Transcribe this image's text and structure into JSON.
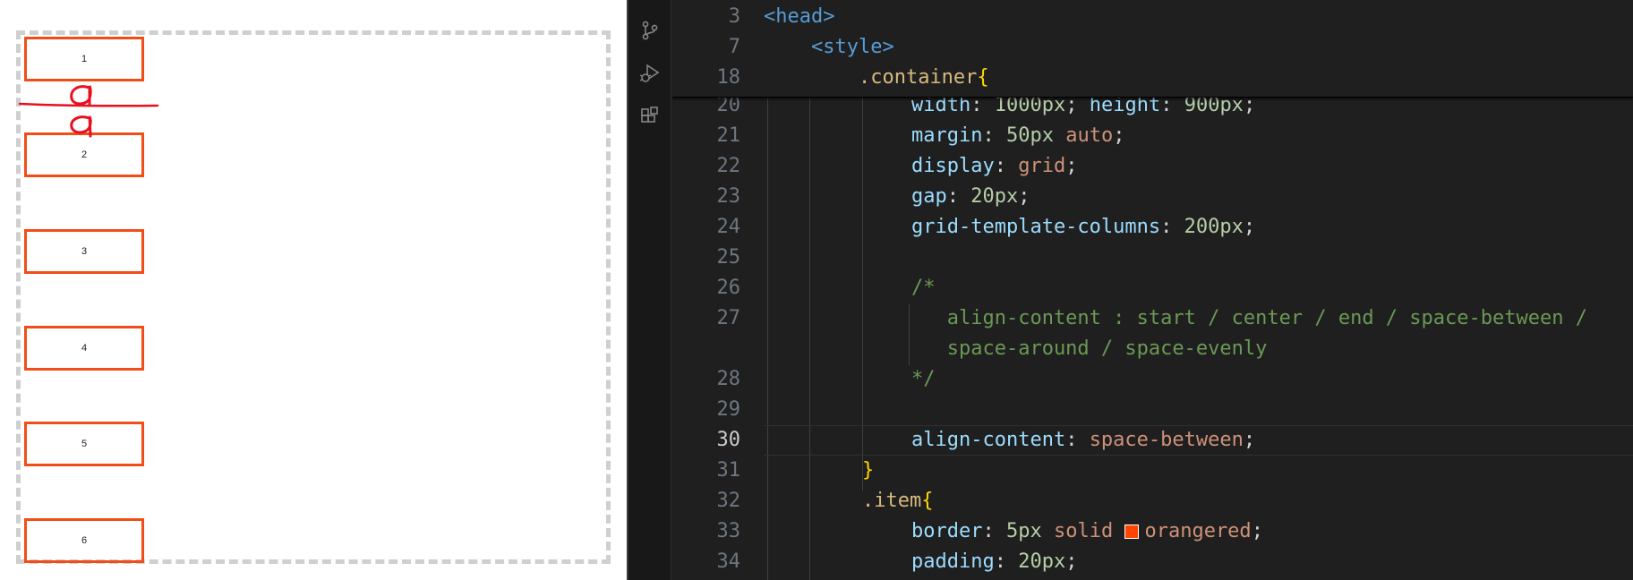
{
  "preview": {
    "items": [
      "1",
      "2",
      "3",
      "4",
      "5",
      "6"
    ],
    "annotation": "handwritten red strokes between item 1 and item 2"
  },
  "activity_bar": {
    "icons": [
      "source-control-icon",
      "run-debug-icon",
      "extensions-icon"
    ]
  },
  "editor": {
    "sticky": [
      {
        "ln": "3",
        "indent": "",
        "parts": [
          {
            "c": "tag",
            "t": "<head>"
          }
        ]
      },
      {
        "ln": "7",
        "indent": "    ",
        "parts": [
          {
            "c": "tag",
            "t": "<style>"
          }
        ]
      },
      {
        "ln": "18",
        "indent": "        ",
        "parts": [
          {
            "c": "sel",
            "t": ".container"
          },
          {
            "c": "brace",
            "t": "{"
          }
        ]
      }
    ],
    "lines": [
      {
        "ln": "20",
        "parts": [
          {
            "c": "prop",
            "t": "width"
          },
          {
            "c": "plain",
            "t": ": "
          },
          {
            "c": "num",
            "t": "1000px"
          },
          {
            "c": "plain",
            "t": "; "
          },
          {
            "c": "prop",
            "t": "height"
          },
          {
            "c": "plain",
            "t": ": "
          },
          {
            "c": "num",
            "t": "900px"
          },
          {
            "c": "plain",
            "t": ";"
          }
        ]
      },
      {
        "ln": "21",
        "parts": [
          {
            "c": "prop",
            "t": "margin"
          },
          {
            "c": "plain",
            "t": ": "
          },
          {
            "c": "num",
            "t": "50px"
          },
          {
            "c": "plain",
            "t": " "
          },
          {
            "c": "kw",
            "t": "auto"
          },
          {
            "c": "plain",
            "t": ";"
          }
        ]
      },
      {
        "ln": "22",
        "parts": [
          {
            "c": "prop",
            "t": "display"
          },
          {
            "c": "plain",
            "t": ": "
          },
          {
            "c": "kw",
            "t": "grid"
          },
          {
            "c": "plain",
            "t": ";"
          }
        ]
      },
      {
        "ln": "23",
        "parts": [
          {
            "c": "prop",
            "t": "gap"
          },
          {
            "c": "plain",
            "t": ": "
          },
          {
            "c": "num",
            "t": "20px"
          },
          {
            "c": "plain",
            "t": ";"
          }
        ]
      },
      {
        "ln": "24",
        "parts": [
          {
            "c": "prop",
            "t": "grid-template-columns"
          },
          {
            "c": "plain",
            "t": ": "
          },
          {
            "c": "num",
            "t": "200px"
          },
          {
            "c": "plain",
            "t": ";"
          }
        ]
      },
      {
        "ln": "25",
        "parts": []
      },
      {
        "ln": "26",
        "parts": [
          {
            "c": "cmt",
            "t": "/*"
          }
        ]
      },
      {
        "ln": "27",
        "parts": [
          {
            "c": "cmt",
            "t": "   align-content : start / center / end / space-between /"
          }
        ]
      },
      {
        "ln": "",
        "parts": [
          {
            "c": "cmt",
            "t": "   space-around / space-evenly"
          }
        ]
      },
      {
        "ln": "28",
        "parts": [
          {
            "c": "cmt",
            "t": "*/"
          }
        ]
      },
      {
        "ln": "29",
        "parts": []
      },
      {
        "ln": "30",
        "active": true,
        "parts": [
          {
            "c": "prop",
            "t": "align-content"
          },
          {
            "c": "plain",
            "t": ": "
          },
          {
            "c": "kw",
            "t": "space-between"
          },
          {
            "c": "plain",
            "t": ";"
          }
        ]
      },
      {
        "ln": "31",
        "outdent": true,
        "parts": [
          {
            "c": "brace",
            "t": "}"
          }
        ]
      },
      {
        "ln": "32",
        "outdent": true,
        "parts": [
          {
            "c": "sel",
            "t": ".item"
          },
          {
            "c": "brace",
            "t": "{"
          }
        ]
      },
      {
        "ln": "33",
        "parts": [
          {
            "c": "prop",
            "t": "border"
          },
          {
            "c": "plain",
            "t": ": "
          },
          {
            "c": "num",
            "t": "5px"
          },
          {
            "c": "plain",
            "t": " "
          },
          {
            "c": "kw",
            "t": "solid"
          },
          {
            "c": "plain",
            "t": " "
          },
          {
            "c": "swatch",
            "t": ""
          },
          {
            "c": "kw",
            "t": "orangered"
          },
          {
            "c": "plain",
            "t": ";"
          }
        ]
      },
      {
        "ln": "34",
        "parts": [
          {
            "c": "prop",
            "t": "padding"
          },
          {
            "c": "plain",
            "t": ": "
          },
          {
            "c": "num",
            "t": "20px"
          },
          {
            "c": "plain",
            "t": ";"
          }
        ]
      }
    ]
  },
  "colors": {
    "item_border": "#f24d16",
    "annotation": "#e8101e",
    "swatch": "#ff4500"
  }
}
